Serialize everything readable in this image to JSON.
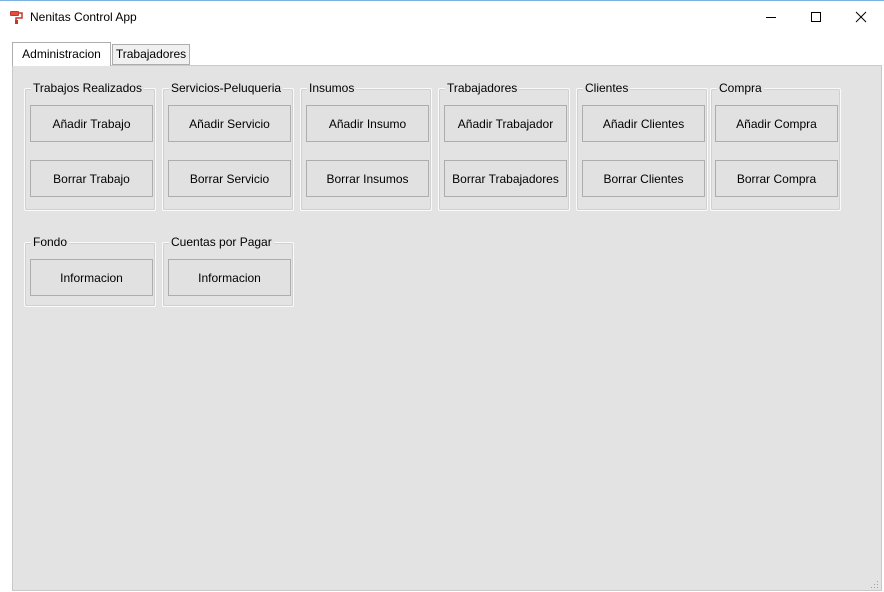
{
  "window": {
    "title": "Nenitas Control App"
  },
  "icons": {
    "app": "paint-roller-icon",
    "minimize": "minimize-icon",
    "maximize": "maximize-icon",
    "close": "close-icon"
  },
  "tabs": [
    {
      "label": "Administracion",
      "active": true
    },
    {
      "label": "Trabajadores",
      "active": false
    }
  ],
  "groups": [
    {
      "title": "Trabajos Realizados",
      "buttons": [
        "Añadir Trabajo",
        "Borrar Trabajo"
      ]
    },
    {
      "title": "Servicios-Peluqueria",
      "buttons": [
        "Añadir Servicio",
        "Borrar Servicio"
      ]
    },
    {
      "title": "Insumos",
      "buttons": [
        "Añadir Insumo",
        "Borrar Insumos"
      ]
    },
    {
      "title": "Trabajadores",
      "buttons": [
        "Añadir Trabajador",
        "Borrar Trabajadores"
      ]
    },
    {
      "title": "Clientes",
      "buttons": [
        "Añadir Clientes",
        "Borrar Clientes"
      ]
    },
    {
      "title": "Compra",
      "buttons": [
        "Añadir Compra",
        "Borrar Compra"
      ]
    },
    {
      "title": "Fondo",
      "buttons": [
        "Informacion"
      ]
    },
    {
      "title": "Cuentas por Pagar",
      "buttons": [
        "Informacion"
      ]
    }
  ]
}
